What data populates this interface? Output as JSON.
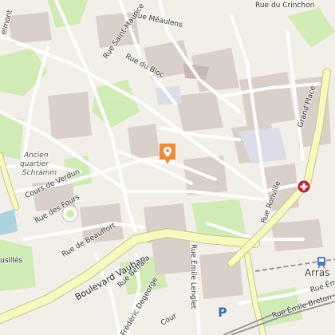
{
  "map": {
    "labels": {
      "rue_gambetta_top": "Rue du Crinchon",
      "rue_meaulens": "Rue Méaulens",
      "rue_saint_maurice": "Rue Saint-Maurice",
      "rue_du_bloc": "Rue du Bloc",
      "belmont": "elmont",
      "ancien_quartier": "Ancien",
      "ancien_quartier_2": "quartier",
      "schramm": "Schramm",
      "cours_de_verdun": "Cours de Verdun",
      "rue_des_fours": "Rue des Fours",
      "rue_de_beauffort": "Rue de Beauffort",
      "boulevard_vauban": "Boulevard Vauban",
      "rue_beffara": "Rue Beffara",
      "rue_emile_lenglet": "Rue Émile Lenglet",
      "rue_frederic_degeorge": "Frédéric Degeorge",
      "rue_ronville": "Rue Ronville",
      "grand_place": "Grand'Place",
      "arras": "Arras",
      "rue_emile_breton_1": "Rue Émile Breton",
      "rue_emile_breton_2": "Rue Émile Breton",
      "rue_des_fusilles": "usillés",
      "rue_court": "Cour"
    },
    "colors": {
      "background": "#f2efe9",
      "building": "#d9d0c9",
      "park": "#cdebb0",
      "road_major": "#f7fabf",
      "road_major_border": "#c9c48a",
      "road_minor": "#ffffff",
      "pedestrian": "#dddde8",
      "rail": "#999999",
      "water": "#aad3df",
      "pin": "#f08a3a",
      "hospital": "#c0202a"
    },
    "icons": [
      "location-pin-icon",
      "hospital-icon",
      "parking-icon",
      "train-station-icon"
    ]
  }
}
